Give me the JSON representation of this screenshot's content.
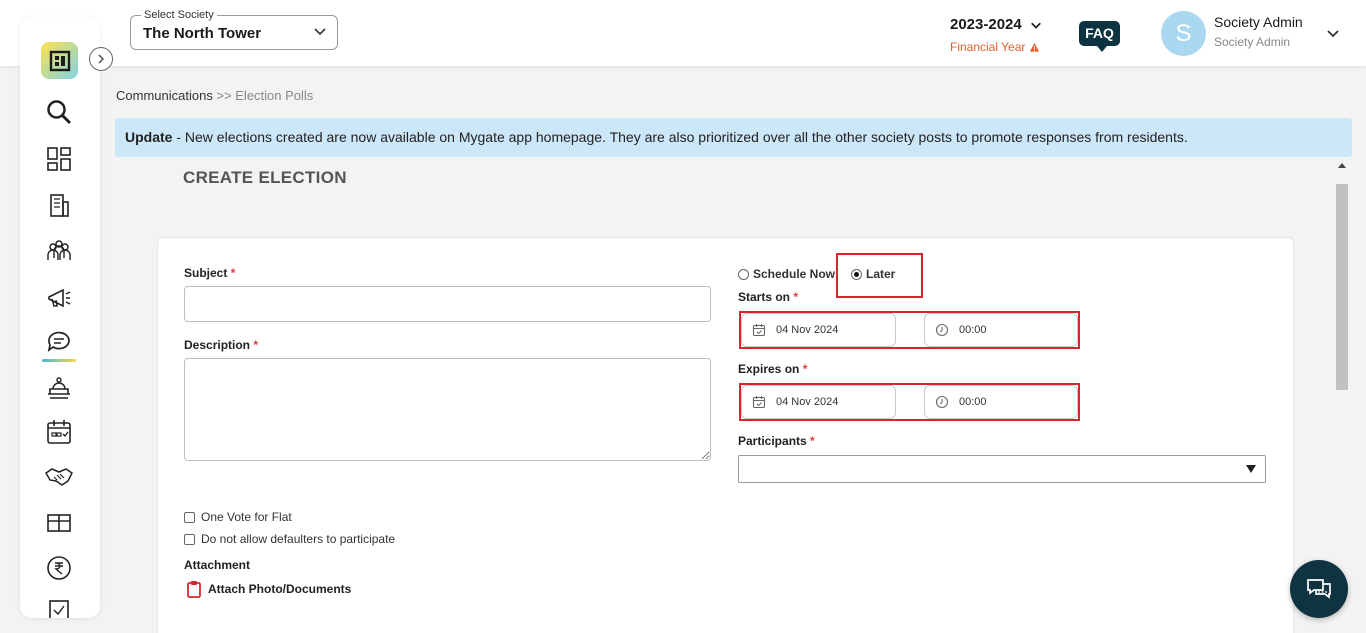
{
  "header": {
    "society_label": "Select Society",
    "society_value": "The North Tower",
    "financial_year": "2023-2024",
    "financial_year_label": "Financial Year",
    "faq_label": "FAQ",
    "avatar_initial": "S",
    "user_name": "Society Admin",
    "user_role": "Society Admin"
  },
  "sidebar": {
    "icons": [
      "logo-icon",
      "search-icon",
      "dashboard-icon",
      "building-icon",
      "residents-icon",
      "megaphone-icon",
      "communications-icon",
      "services-icon",
      "calendar-icon",
      "handshake-icon",
      "gift-icon",
      "rupee-icon",
      "more-icon"
    ],
    "active": "communications-icon"
  },
  "breadcrumb": {
    "root": "Communications",
    "separator": ">>",
    "current": "Election Polls"
  },
  "banner": {
    "bold": "Update",
    "text": " - New elections created are now available on Mygate app homepage. They are also prioritized over all the other society posts to promote responses from residents."
  },
  "page": {
    "title": "CREATE ELECTION"
  },
  "form": {
    "subject_label": "Subject",
    "subject_value": "",
    "description_label": "Description",
    "description_value": "",
    "required_mark": "*",
    "schedule_now_label": "Schedule Now",
    "later_label": "Later",
    "schedule_selected": "Later",
    "starts_on_label": "Starts on",
    "starts_date": "04 Nov 2024",
    "starts_time": "00:00",
    "expires_on_label": "Expires on",
    "expires_date": "04 Nov 2024",
    "expires_time": "00:00",
    "participants_label": "Participants",
    "participants_value": "",
    "one_vote_label": "One Vote for Flat",
    "defaulters_label": "Do not allow defaulters to participate",
    "attachment_label": "Attachment",
    "attach_button": "Attach Photo/Documents"
  },
  "colors": {
    "primary_dark": "#0d3340",
    "accent_orange": "#e4602b",
    "highlight_red": "#d8262d",
    "banner_bg": "#cce7f8"
  }
}
